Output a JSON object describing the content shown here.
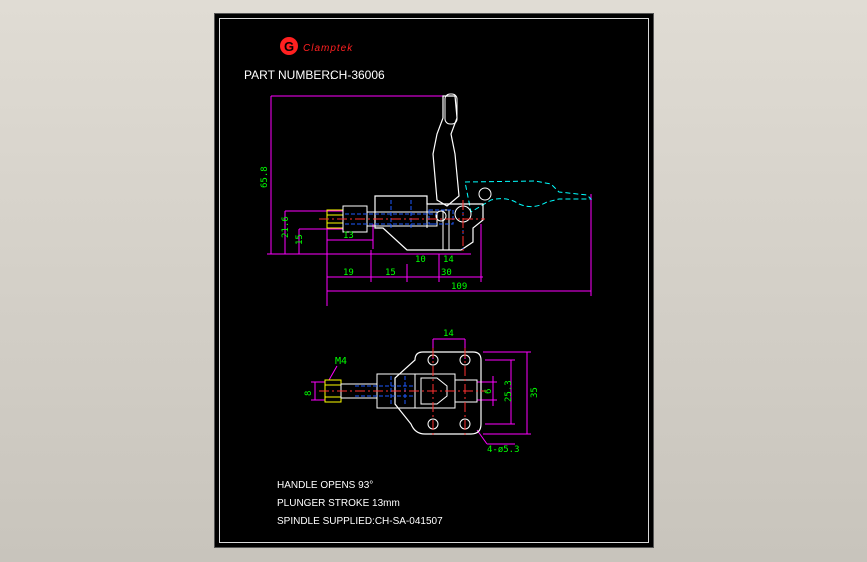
{
  "brand": {
    "logo_letter": "G",
    "name": "Clamptek",
    "color": "#ff2020"
  },
  "part": {
    "label": "PART NUMBER:",
    "value": "CH-36006"
  },
  "dimensions": {
    "height_total": "65.8",
    "height_upper": "21.6",
    "height_base": "15",
    "plunger_tip": "13",
    "len_19": "19",
    "len_15": "15",
    "len_10": "10",
    "len_14": "14",
    "len_30": "30",
    "len_total": "109",
    "top_14": "14",
    "top_35": "35",
    "top_25_3": "25.3",
    "top_6": "6",
    "top_8": "8",
    "thread": "M4",
    "holes": "4-ø5.3"
  },
  "notes": {
    "line1": "HANDLE OPENS 93°",
    "line2": "PLUNGER STROKE 13mm",
    "line3": "SPINDLE SUPPLIED:CH-SA-041507"
  },
  "colors": {
    "part_lines": "#ffffff",
    "dimension_lines": "#ff00ff",
    "dimension_text": "#00ff00",
    "center_lines": "#ff3030",
    "hidden_lines": "#1e5aff",
    "phantom_lines": "#00ffff",
    "threads": "#ffff00"
  }
}
